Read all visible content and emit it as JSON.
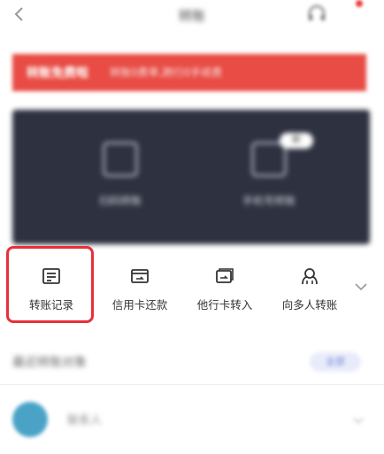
{
  "nav": {
    "title": "转账"
  },
  "banner": {
    "bold": "转账免费啦",
    "text": "转账0费率,跨行0手续费"
  },
  "card": {
    "items": [
      {
        "label": "扫码转账",
        "icon": "scan-transfer-icon"
      },
      {
        "label": "手机号转账",
        "icon": "phone-transfer-icon"
      }
    ],
    "badge": "新"
  },
  "actions": [
    {
      "label": "转账记录",
      "icon": "transfer-record-icon"
    },
    {
      "label": "信用卡还款",
      "icon": "credit-card-repay-icon"
    },
    {
      "label": "他行卡转入",
      "icon": "other-bank-transfer-in-icon"
    },
    {
      "label": "向多人转账",
      "icon": "multi-person-transfer-icon"
    }
  ],
  "recent": {
    "title": "最近转账对象",
    "pill": "全部"
  },
  "contact": {
    "name": "联系人"
  },
  "colors": {
    "accent": "#e8303a",
    "banner": "#e84c44",
    "card": "#2d3140"
  }
}
